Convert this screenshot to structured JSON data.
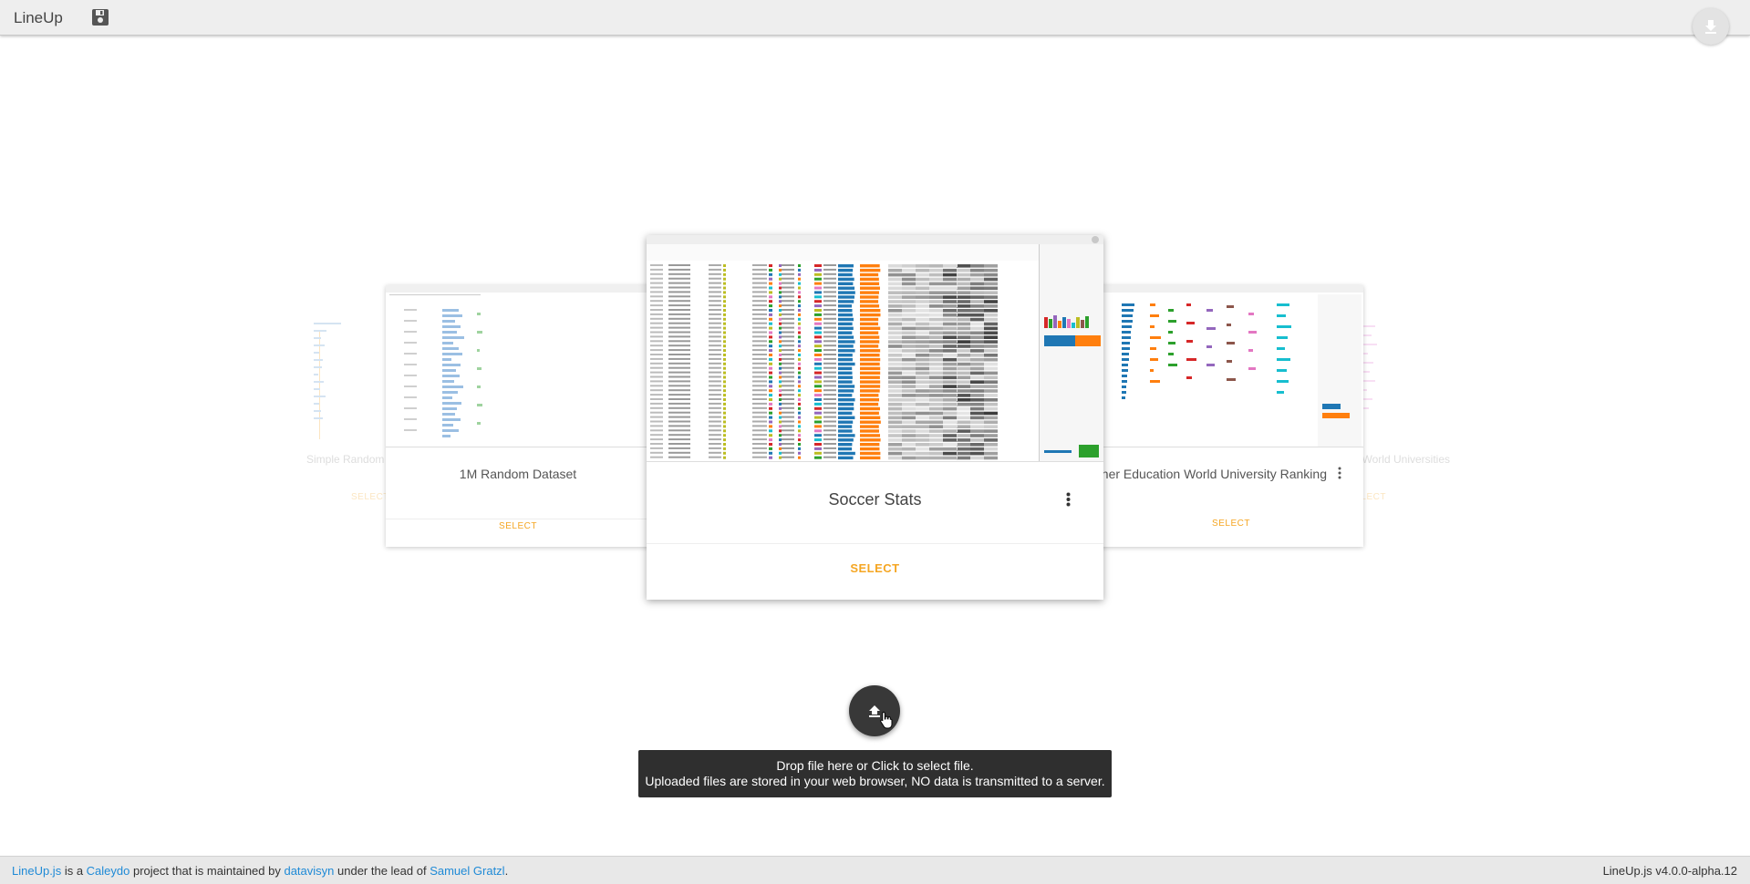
{
  "app": {
    "title": "LineUp",
    "version": "LineUp.js v4.0.0-alpha.12"
  },
  "toolbar": {
    "save_icon": "floppy-disk-icon",
    "download_icon": "download-icon"
  },
  "carousel": {
    "cards": [
      {
        "title": "Simple Random Dataset",
        "select_label": "SELECT"
      },
      {
        "title": "1M Random Dataset",
        "select_label": "SELECT"
      },
      {
        "title": "Soccer Stats",
        "select_label": "SELECT"
      },
      {
        "title": "Times Higher Education World University Ranking",
        "select_label": "SELECT"
      },
      {
        "title": "Academic Ranking of World Universities",
        "select_label": "SELECT"
      }
    ]
  },
  "upload": {
    "icon": "upload-icon",
    "line1": "Drop file here or Click to select file.",
    "line2": "Uploaded files are stored in your web browser, NO data is transmitted to a server."
  },
  "footer": {
    "link_lineup": "LineUp.js",
    "text_is_a": " is a ",
    "link_caleydo": "Caleydo",
    "text_maintained": " project that is maintained by ",
    "link_datavisyn": "datavisyn",
    "text_lead": " under the lead of ",
    "link_author": "Samuel Gratzl",
    "text_end": "."
  },
  "colors": {
    "accent": "#f5a623",
    "link": "#1f8ad6",
    "bar_blue": "#1f77b4",
    "bar_orange": "#ff7f0e"
  }
}
